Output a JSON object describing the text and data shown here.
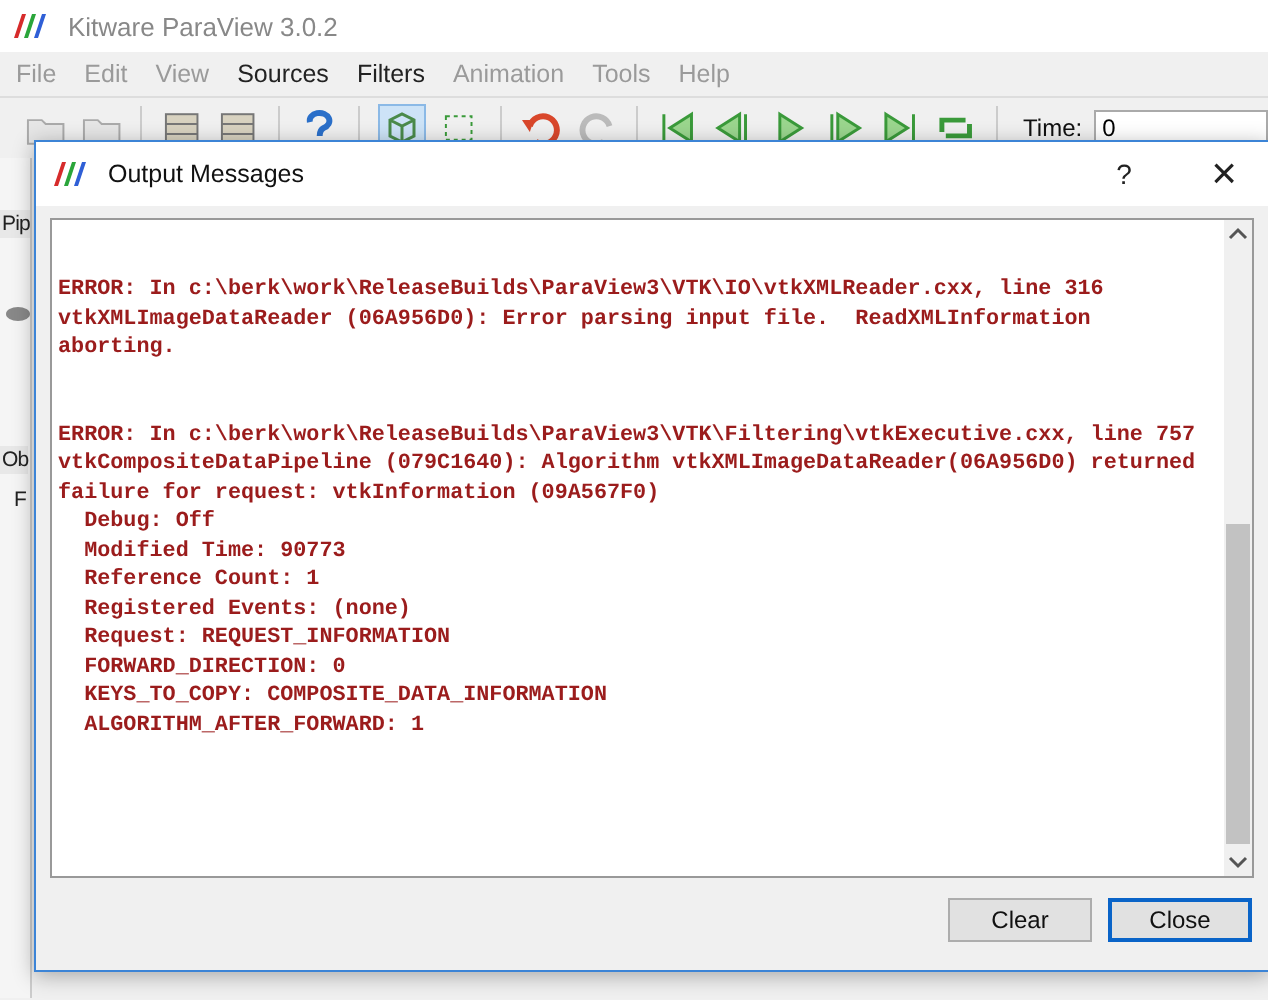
{
  "window": {
    "title": "Kitware ParaView 3.0.2"
  },
  "menu": [
    {
      "label": "File",
      "disabled": true
    },
    {
      "label": "Edit",
      "disabled": true
    },
    {
      "label": "View",
      "disabled": true
    },
    {
      "label": "Sources",
      "disabled": false
    },
    {
      "label": "Filters",
      "disabled": false
    },
    {
      "label": "Animation",
      "disabled": true
    },
    {
      "label": "Tools",
      "disabled": true
    },
    {
      "label": "Help",
      "disabled": true
    }
  ],
  "toolbar": {
    "time_label": "Time:",
    "time_value": "0"
  },
  "side_panel": {
    "pipeline_tab": "Pip",
    "object_tab": "Ob",
    "properties_tab": "F"
  },
  "dialog": {
    "title": "Output Messages",
    "help": "?",
    "close": "×",
    "messages": [
      {
        "lines": [
          "ERROR: In c:\\berk\\work\\ReleaseBuilds\\ParaView3\\VTK\\IO\\vtkXMLReader.cxx, line 316",
          "vtkXMLImageDataReader (06A956D0): Error parsing input file.  ReadXMLInformation",
          "aborting."
        ]
      },
      {
        "lines": [
          "ERROR: In c:\\berk\\work\\ReleaseBuilds\\ParaView3\\VTK\\Filtering\\vtkExecutive.cxx, line 757",
          "vtkCompositeDataPipeline (079C1640): Algorithm vtkXMLImageDataReader(06A956D0) returned",
          "failure for request: vtkInformation (09A567F0)",
          "  Debug: Off",
          "  Modified Time: 90773",
          "  Reference Count: 1",
          "  Registered Events: (none)",
          "  Request: REQUEST_INFORMATION",
          "  FORWARD_DIRECTION: 0",
          "  KEYS_TO_COPY: COMPOSITE_DATA_INFORMATION",
          "  ALGORITHM_AFTER_FORWARD: 1"
        ]
      }
    ],
    "buttons": [
      {
        "label": "Clear",
        "selected": false
      },
      {
        "label": "Close",
        "selected": true
      }
    ]
  }
}
